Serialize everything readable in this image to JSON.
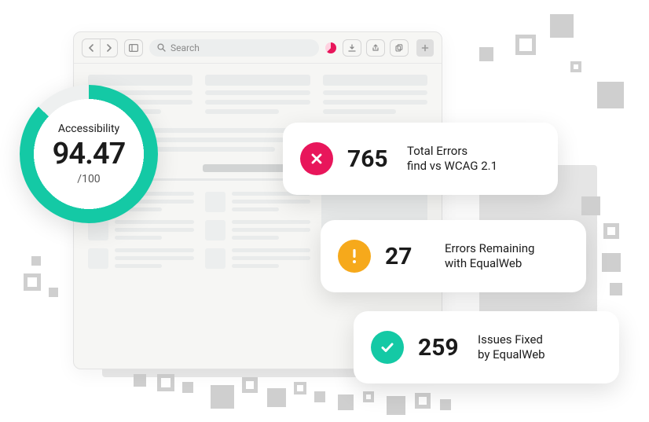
{
  "browser": {
    "search_placeholder": "Search"
  },
  "score": {
    "label": "Accessibility",
    "value": "94.47",
    "max": "/100"
  },
  "metrics": {
    "errors": {
      "count": "765",
      "line1": "Total Errors",
      "line2": "find vs WCAG 2.1"
    },
    "remaining": {
      "count": "27",
      "line1": "Errors Remaining",
      "line2": "with EqualWeb"
    },
    "fixed": {
      "count": "259",
      "line1": "Issues Fixed",
      "line2": "by EqualWeb"
    }
  }
}
